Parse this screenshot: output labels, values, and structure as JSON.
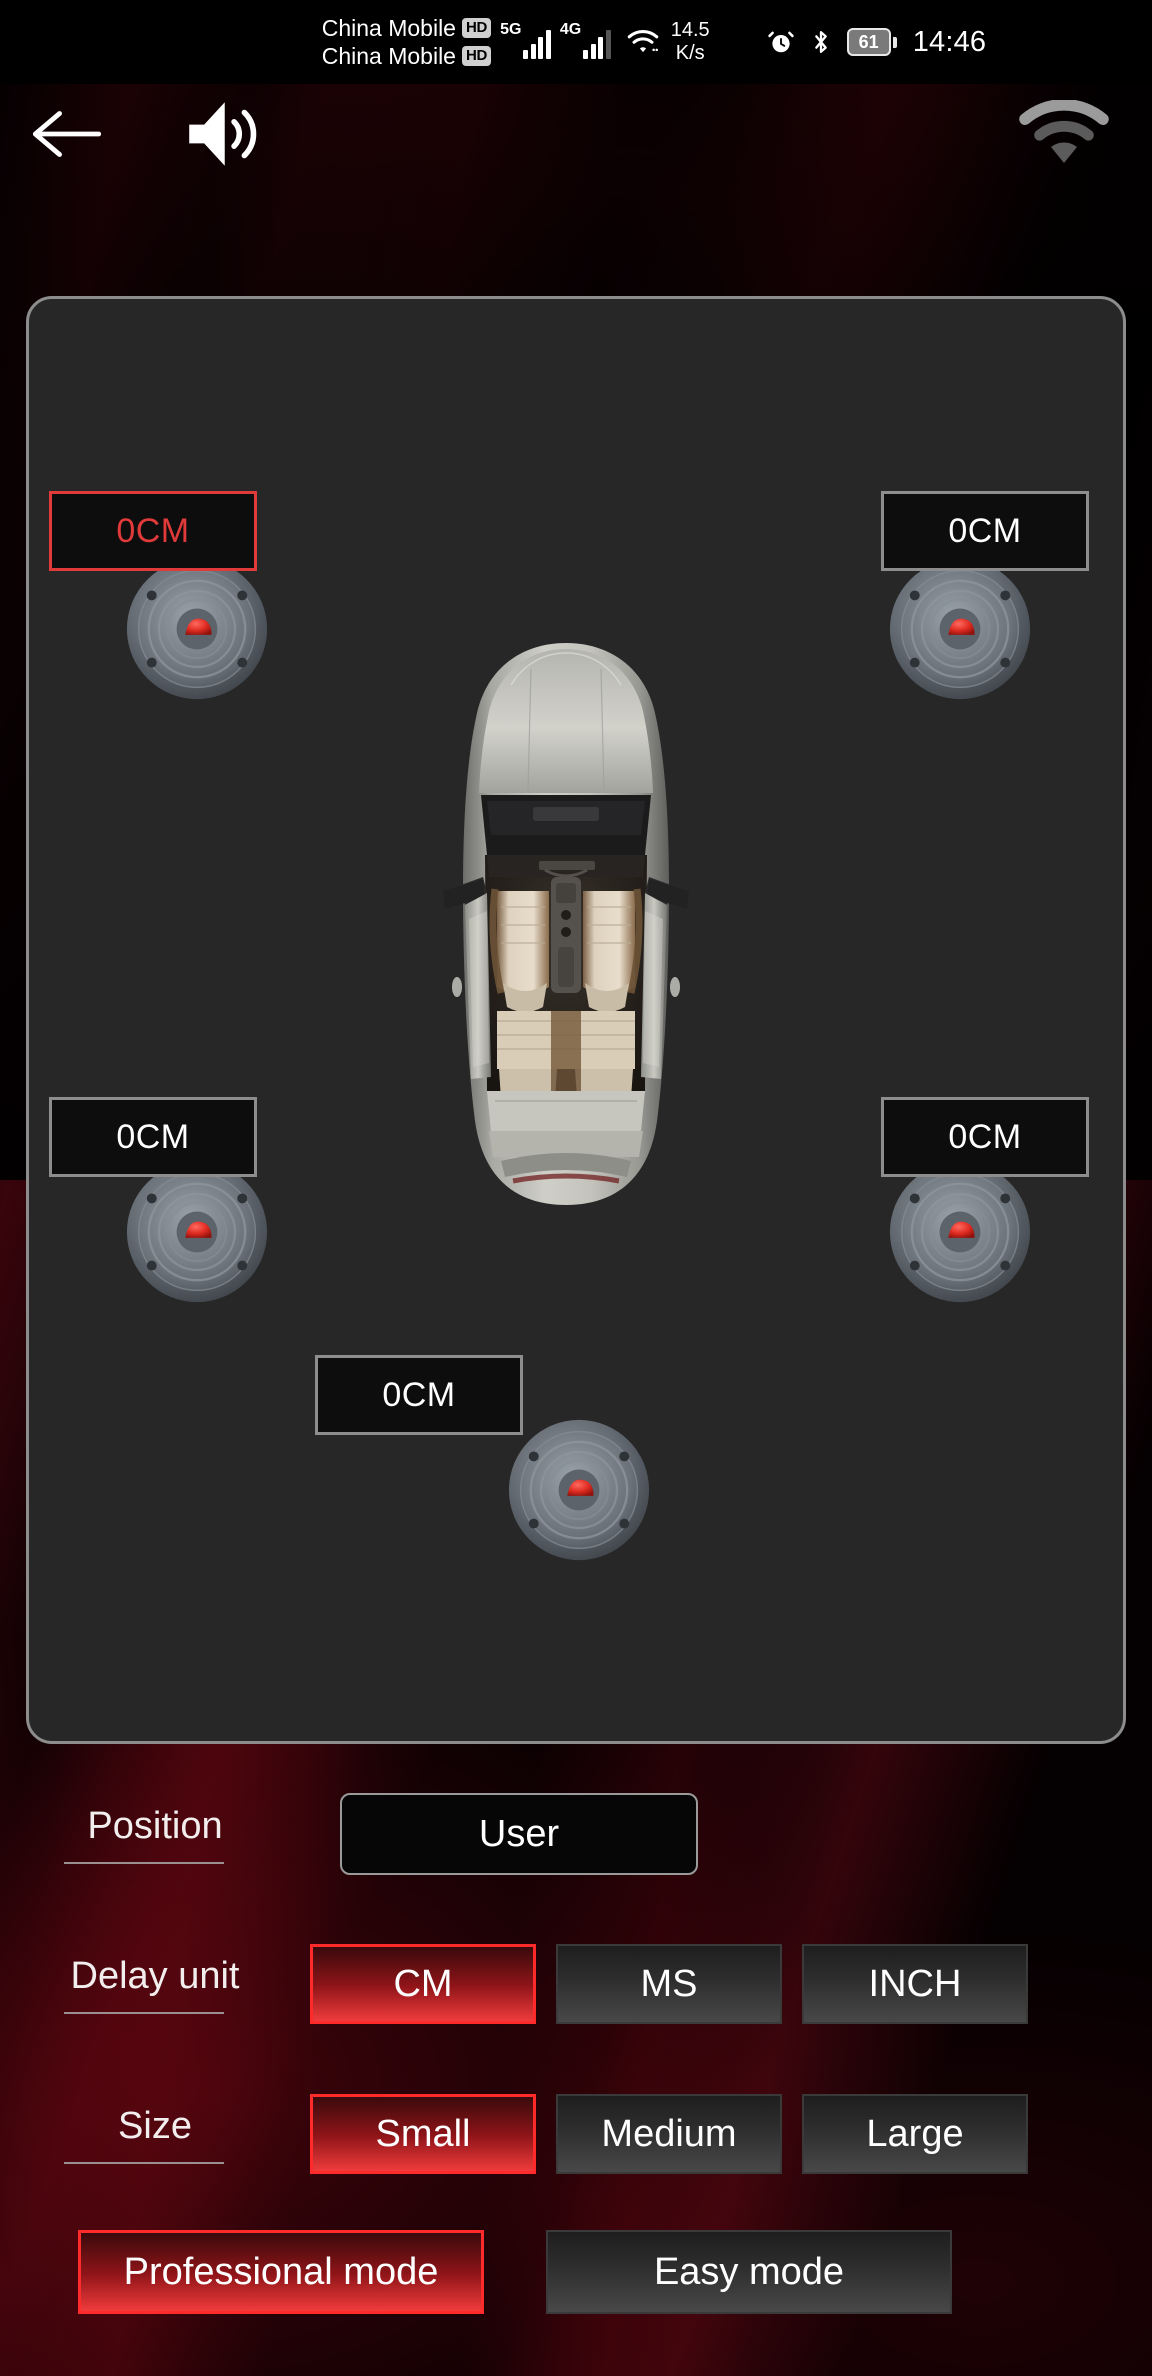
{
  "status_bar": {
    "carriers": [
      {
        "name": "China Mobile",
        "badge": "HD"
      },
      {
        "name": "China Mobile",
        "badge": "HD"
      }
    ],
    "networks": [
      {
        "label": "5G",
        "bars": 4
      },
      {
        "label": "4G",
        "bars": 3
      }
    ],
    "wifi_icon": "wifi-icon",
    "net_speed_value": "14.5",
    "net_speed_unit": "K/s",
    "alarm_icon": "alarm-clock-icon",
    "bluetooth_icon": "bluetooth-icon",
    "battery_level": "61",
    "time": "14:46"
  },
  "nav_bar": {
    "back_icon": "back-arrow-icon",
    "volume_icon": "volume-speaker-icon",
    "wifi_icon": "wifi-icon"
  },
  "diagram": {
    "car_icon": "car-top-view-icon",
    "speakers": [
      {
        "position": "front-left",
        "icon": "speaker-icon",
        "value": "0CM",
        "active": true
      },
      {
        "position": "front-right",
        "icon": "speaker-icon",
        "value": "0CM",
        "active": false
      },
      {
        "position": "rear-left",
        "icon": "speaker-icon",
        "value": "0CM",
        "active": false
      },
      {
        "position": "rear-right",
        "icon": "speaker-icon",
        "value": "0CM",
        "active": false
      },
      {
        "position": "subwoofer",
        "icon": "speaker-icon",
        "value": "0CM",
        "active": false
      }
    ]
  },
  "controls": {
    "position": {
      "label": "Position",
      "selected": "User"
    },
    "delay_unit": {
      "label": "Delay unit",
      "options": [
        "CM",
        "MS",
        "INCH"
      ],
      "selected": "CM"
    },
    "size": {
      "label": "Size",
      "options": [
        "Small",
        "Medium",
        "Large"
      ],
      "selected": "Small"
    },
    "mode": {
      "options": [
        "Professional mode",
        "Easy mode"
      ],
      "selected": "Professional mode"
    }
  },
  "colors": {
    "accent_red": "#ff2b2b",
    "active_text_red": "#e03a3a",
    "panel_bg": "#272727",
    "panel_border": "#8d8d8d",
    "button_bg": "#2e2e2e"
  }
}
